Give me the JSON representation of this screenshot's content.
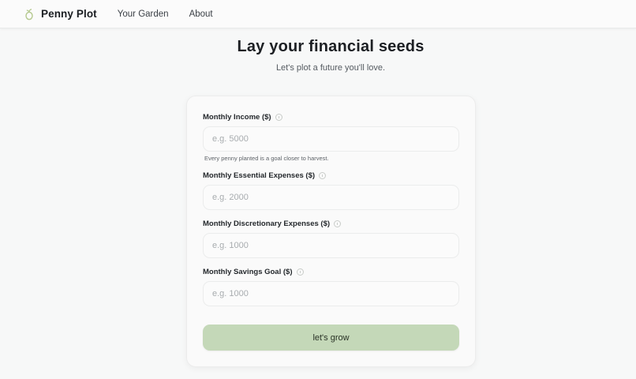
{
  "nav": {
    "brand": "Penny Plot",
    "links": [
      "Your Garden",
      "About"
    ]
  },
  "hero": {
    "title": "Lay your financial seeds",
    "subtitle": "Let's plot a future you'll love."
  },
  "form": {
    "fields": [
      {
        "label": "Monthly Income ($)",
        "placeholder": "e.g. 5000",
        "hint": "Every penny planted is a goal closer to harvest."
      },
      {
        "label": "Monthly Essential Expenses ($)",
        "placeholder": "e.g. 2000"
      },
      {
        "label": "Monthly Discretionary Expenses ($)",
        "placeholder": "e.g. 1000"
      },
      {
        "label": "Monthly Savings Goal ($)",
        "placeholder": "e.g. 1000"
      }
    ],
    "submit_label": "let's grow"
  },
  "colors": {
    "accent": "#c4d8b8",
    "icon": "#b5c98f"
  },
  "icons": {
    "brand": "seed-sprout-icon",
    "info": "info-icon"
  }
}
